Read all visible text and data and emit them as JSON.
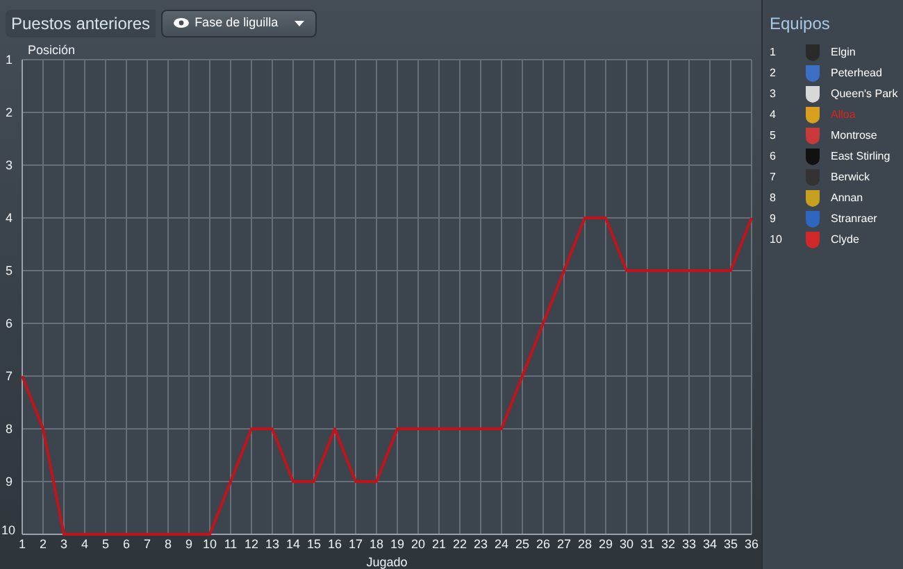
{
  "header": {
    "title": "Puestos anteriores",
    "filter_button": {
      "label": "Fase de liguilla"
    }
  },
  "chart": {
    "chart_data": {
      "type": "line",
      "grid": true,
      "xlabel": "Jugado",
      "ylabel": "Posición",
      "x": [
        1,
        2,
        3,
        4,
        5,
        6,
        7,
        8,
        9,
        10,
        11,
        12,
        13,
        14,
        15,
        16,
        17,
        18,
        19,
        20,
        21,
        22,
        23,
        24,
        25,
        26,
        27,
        28,
        29,
        30,
        31,
        32,
        33,
        34,
        35,
        36
      ],
      "xlim": [
        1,
        36
      ],
      "ylim": [
        10,
        1
      ],
      "xticks": [
        1,
        2,
        3,
        4,
        5,
        6,
        7,
        8,
        9,
        10,
        11,
        12,
        13,
        14,
        15,
        16,
        17,
        18,
        19,
        20,
        21,
        22,
        23,
        24,
        25,
        26,
        27,
        28,
        29,
        30,
        31,
        32,
        33,
        34,
        35,
        36
      ],
      "yticks": [
        1,
        2,
        3,
        4,
        5,
        6,
        7,
        8,
        9,
        10
      ],
      "series": [
        {
          "color": "#c0141a",
          "values": [
            7,
            8,
            10,
            10,
            10,
            10,
            10,
            10,
            10,
            10,
            9,
            8,
            8,
            9,
            9,
            8,
            9,
            9,
            8,
            8,
            8,
            8,
            8,
            8,
            7,
            6,
            5,
            4,
            4,
            5,
            5,
            5,
            5,
            5,
            5,
            4
          ]
        }
      ]
    }
  },
  "teams": {
    "title": "Equipos",
    "items": [
      {
        "rank": "1",
        "name": "Elgin",
        "color": "#2a2a2a",
        "selected": false
      },
      {
        "rank": "2",
        "name": "Peterhead",
        "color": "#3b6fc4",
        "selected": false
      },
      {
        "rank": "3",
        "name": "Queen's Park",
        "color": "#d8d8d8",
        "selected": false
      },
      {
        "rank": "4",
        "name": "Alloa",
        "color": "#d9a020",
        "selected": true
      },
      {
        "rank": "5",
        "name": "Montrose",
        "color": "#c83a3a",
        "selected": false
      },
      {
        "rank": "6",
        "name": "East Stirling",
        "color": "#111111",
        "selected": false
      },
      {
        "rank": "7",
        "name": "Berwick",
        "color": "#333333",
        "selected": false
      },
      {
        "rank": "8",
        "name": "Annan",
        "color": "#c8a020",
        "selected": false
      },
      {
        "rank": "9",
        "name": "Stranraer",
        "color": "#2f66c0",
        "selected": false
      },
      {
        "rank": "10",
        "name": "Clyde",
        "color": "#d02828",
        "selected": false
      }
    ]
  }
}
